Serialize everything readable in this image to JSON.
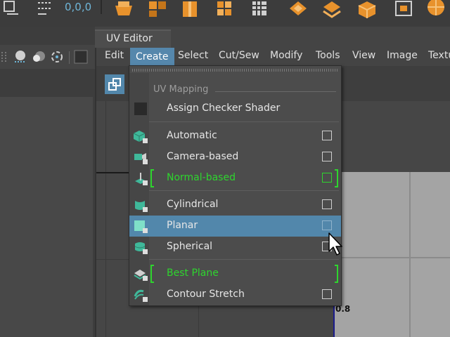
{
  "top_shelf": {
    "coord_readout": "0,0,0"
  },
  "uv_editor": {
    "tab_title": "UV Editor",
    "menu": [
      "Edit",
      "Create",
      "Select",
      "Cut/Sew",
      "Modify",
      "Tools",
      "View",
      "Image",
      "Textu"
    ],
    "active_menu": "Create",
    "viewport_tick_label": "0.8"
  },
  "create_menu": {
    "section_title": "UV Mapping",
    "items": [
      {
        "label": "Assign Checker Shader",
        "icon": "checker-shader-icon",
        "has_option_box": false,
        "highlighted": false,
        "marked": false
      },
      {
        "label": "Automatic",
        "icon": "automatic-mapping-icon",
        "has_option_box": true,
        "highlighted": false,
        "marked": false
      },
      {
        "label": "Camera-based",
        "icon": "camera-mapping-icon",
        "has_option_box": true,
        "highlighted": false,
        "marked": false
      },
      {
        "label": "Normal-based",
        "icon": "normal-mapping-icon",
        "has_option_box": true,
        "highlighted": false,
        "marked": true
      },
      {
        "label": "Cylindrical",
        "icon": "cylindrical-mapping-icon",
        "has_option_box": true,
        "highlighted": false,
        "marked": false
      },
      {
        "label": "Planar",
        "icon": "planar-mapping-icon",
        "has_option_box": true,
        "highlighted": true,
        "marked": false
      },
      {
        "label": "Spherical",
        "icon": "spherical-mapping-icon",
        "has_option_box": true,
        "highlighted": false,
        "marked": false
      },
      {
        "label": "Best Plane",
        "icon": "best-plane-icon",
        "has_option_box": false,
        "highlighted": false,
        "marked": true
      },
      {
        "label": "Contour Stretch",
        "icon": "contour-stretch-icon",
        "has_option_box": true,
        "highlighted": false,
        "marked": false
      }
    ]
  },
  "colors": {
    "highlight": "#5287ab",
    "marked_green": "#2ed52e",
    "shelf_orange": "#e8922c",
    "coord_blue": "#6fb6d8"
  }
}
